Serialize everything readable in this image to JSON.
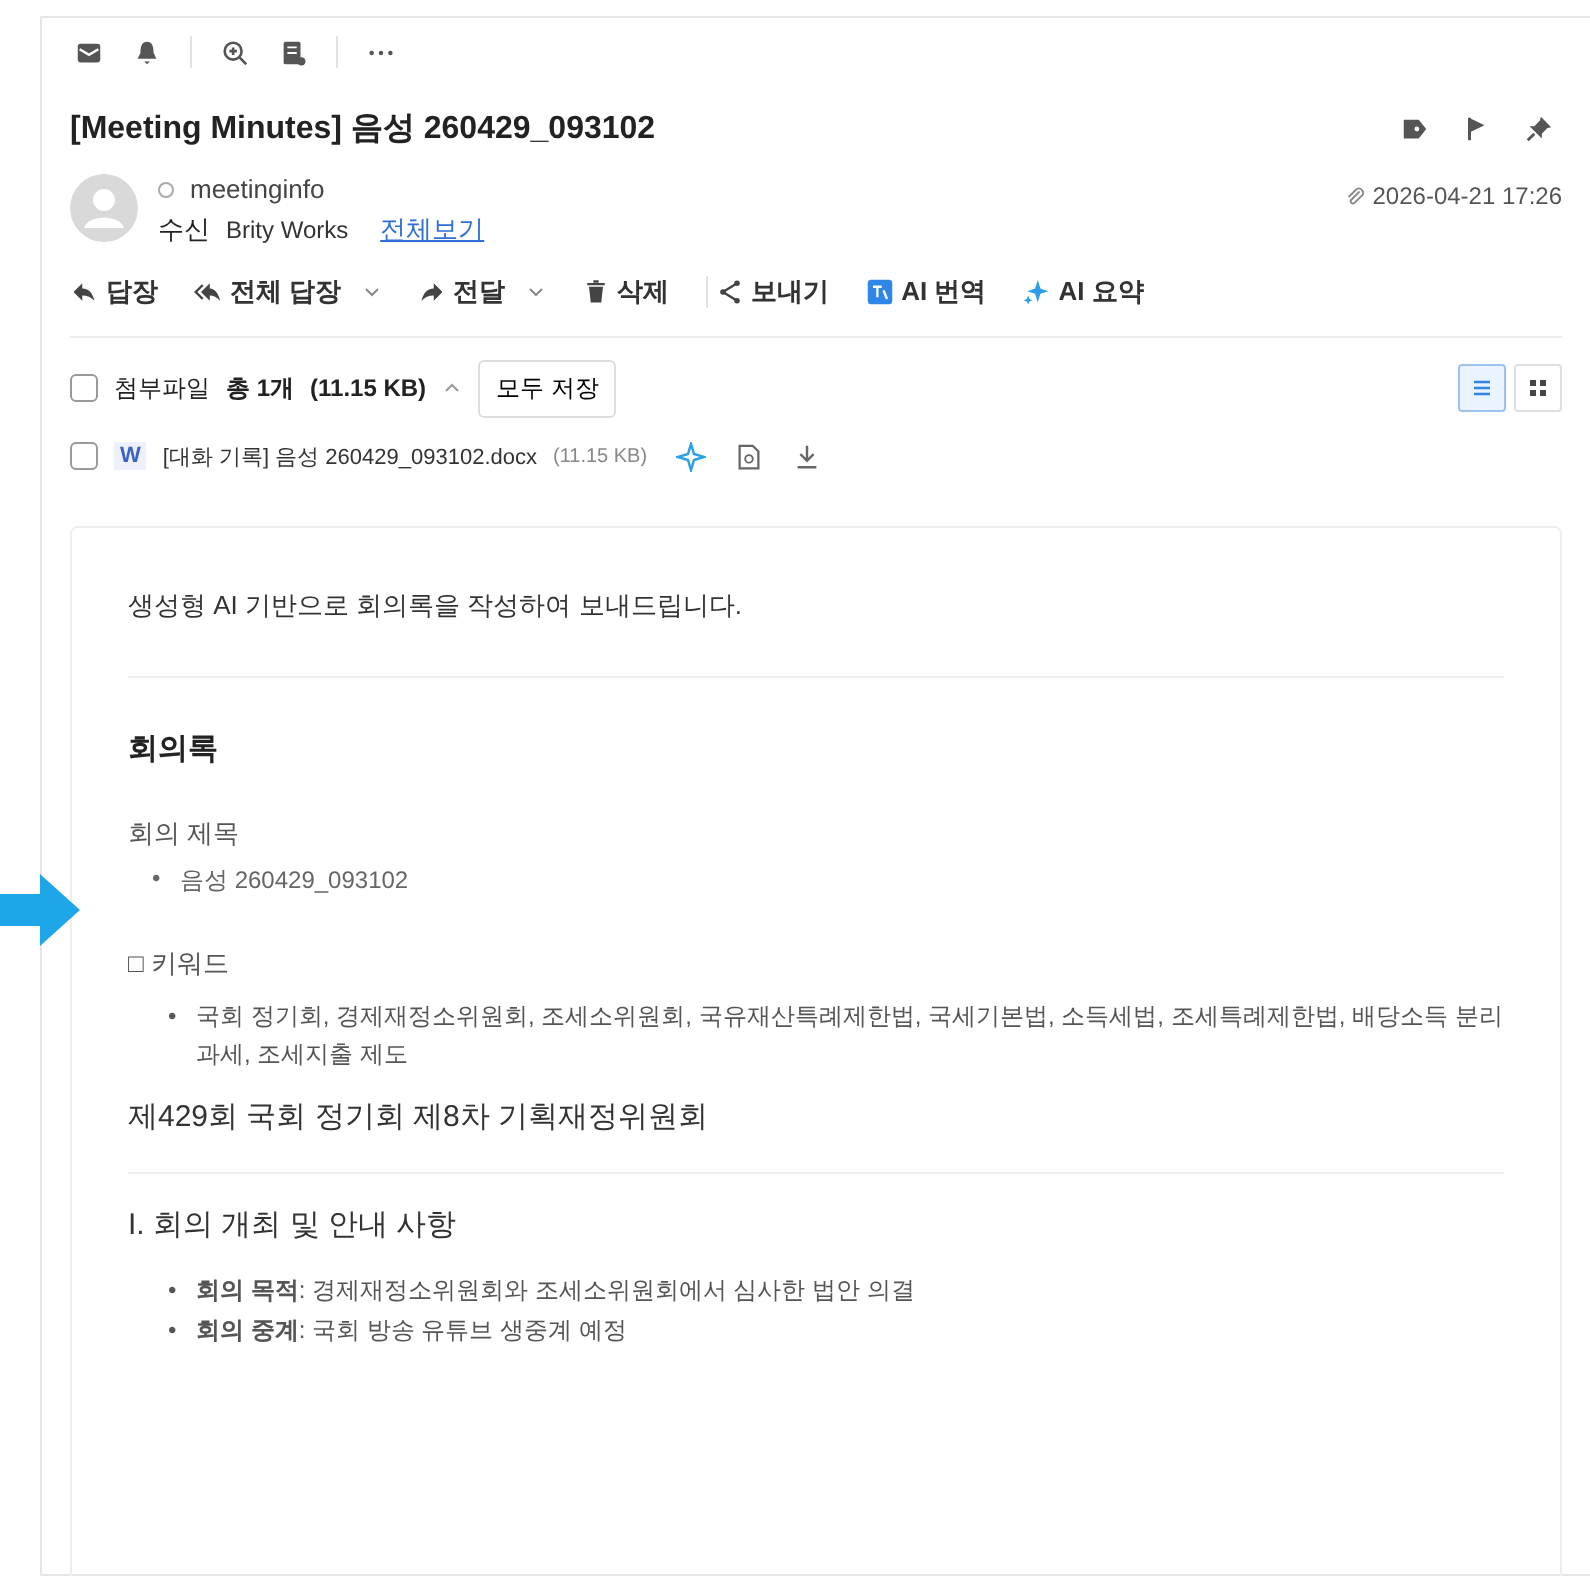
{
  "toolbar": {
    "icons": [
      {
        "kind": "mail"
      },
      {
        "kind": "bell"
      },
      {
        "kind": "zoom"
      },
      {
        "kind": "memo"
      },
      {
        "kind": "more"
      }
    ]
  },
  "message": {
    "title": "[Meeting Minutes] 음성 260429_093102",
    "title_icons": [
      {
        "kind": "label"
      },
      {
        "kind": "flag"
      },
      {
        "kind": "pin"
      }
    ],
    "sender": "meetinginfo",
    "sender_online": false,
    "recipient_label": "수신",
    "recipient": "Brity Works",
    "view_all": "전체보기",
    "date": "2026-04-21 17:26"
  },
  "actions": [
    {
      "kind": "reply",
      "label": "답장",
      "dropdown": false
    },
    {
      "kind": "reply_all",
      "label": "전체 답장",
      "dropdown": true
    },
    {
      "kind": "forward",
      "label": "전달",
      "dropdown": true
    },
    {
      "kind": "delete",
      "label": "삭제",
      "dropdown": false
    },
    {
      "kind": "share",
      "label": "보내기",
      "dropdown": false
    },
    {
      "kind": "translate",
      "label": "AI 번역",
      "dropdown": false
    },
    {
      "kind": "summary",
      "label": "AI 요약",
      "dropdown": false
    }
  ],
  "attachments": {
    "checked": false,
    "label": "첨부파일",
    "count": "총 1개",
    "size": "(11.15 KB)",
    "expanded": true,
    "save_all": "모두 저장",
    "views": [
      {
        "kind": "list",
        "selected": true
      },
      {
        "kind": "grid",
        "selected": false
      }
    ],
    "files": [
      {
        "checked": false,
        "type_letter": "W",
        "name": "[대화 기록] 음성 260429_093102.docx",
        "size": "(11.15 KB)"
      }
    ]
  },
  "body": {
    "bullet": "•",
    "intro": "생성형 AI 기반으로 회의록을 작성하여 보내드립니다.",
    "heading": "회의록",
    "title_label": "회의 제목",
    "title_items": [
      "음성 260429_093102"
    ],
    "keyword_label": "□ 키워드",
    "keyword_items": [
      "국회 정기회, 경제재정소위원회, 조세소위원회, 국유재산특례제한법, 국세기본법, 소득세법, 조세특례제한법, 배당소득 분리과세, 조세지출 제도"
    ],
    "section": "제429회 국회 정기회 제8차 기획재정위원회",
    "subsection": "I. 회의 개최 및 안내 사항",
    "sub_items": [
      "**회의 목적**: 경제재정소위원회와 조세소위원회에서 심사한 법안 의결",
      "**회의 중계**: 국회 방송 유튜브 생중계 예정"
    ]
  }
}
